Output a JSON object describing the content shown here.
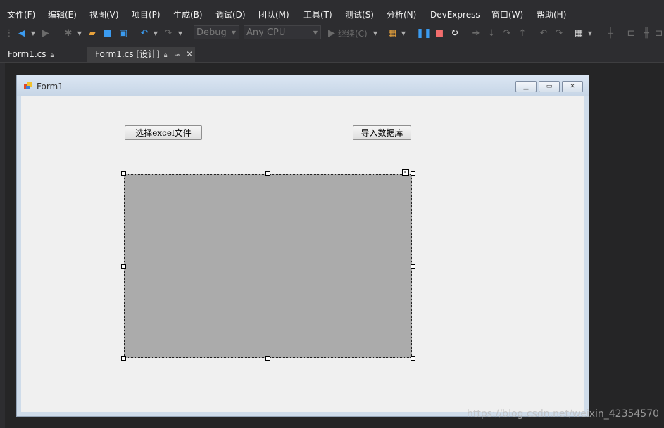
{
  "menu": [
    "文件(F)",
    "编辑(E)",
    "视图(V)",
    "项目(P)",
    "生成(B)",
    "调试(D)",
    "团队(M)",
    "工具(T)",
    "测试(S)",
    "分析(N)",
    "DevExpress",
    "窗口(W)",
    "帮助(H)"
  ],
  "toolbar": {
    "config_combo": "Debug",
    "platform_combo": "Any CPU",
    "continue_label": "继续(C)"
  },
  "tabs": [
    {
      "label": "Form1.cs",
      "active": false
    },
    {
      "label": "Form1.cs [设计]",
      "active": true
    }
  ],
  "form": {
    "title": "Form1",
    "select_button": "选择excel文件",
    "import_button": "导入数据库"
  },
  "watermark": "https://blog.csdn.net/weixin_42354570",
  "colors": {
    "ide_background": "#2d2d30",
    "datagrid_background": "#ababab",
    "form_client": "#f0f0f0"
  }
}
